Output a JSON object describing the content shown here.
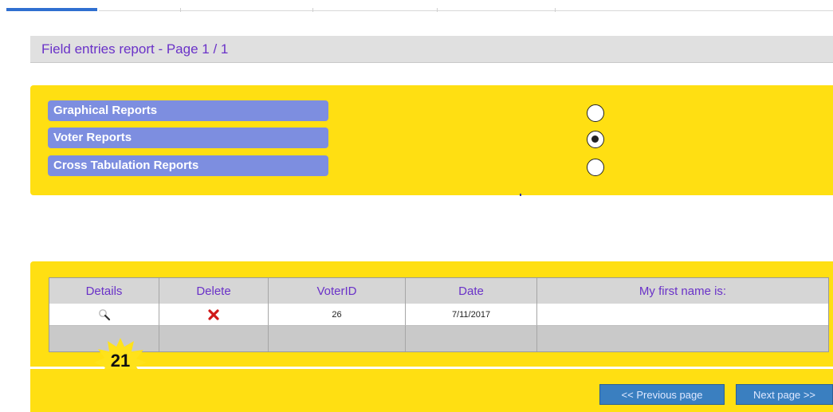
{
  "title": "Field entries report - Page 1 / 1",
  "report_options": [
    {
      "label": "Graphical Reports",
      "selected": false
    },
    {
      "label": "Voter Reports",
      "selected": true
    },
    {
      "label": "Cross Tabulation Reports",
      "selected": false
    }
  ],
  "table": {
    "headers": [
      "Details",
      "Delete",
      "VoterID",
      "Date",
      "My first name is:"
    ],
    "rows": [
      {
        "details_icon": "magnifier-icon",
        "delete_icon": "red-x-icon",
        "voter_id": "26",
        "date": "7/11/2017",
        "first_name": ""
      }
    ]
  },
  "badge": "21",
  "pager": {
    "previous": "<< Previous page",
    "next": "Next page >>"
  },
  "colors": {
    "panel": "#ffdf12",
    "option_bg": "#7d8ee0",
    "header_text": "#6a32c8",
    "button": "#3a7fc0"
  }
}
